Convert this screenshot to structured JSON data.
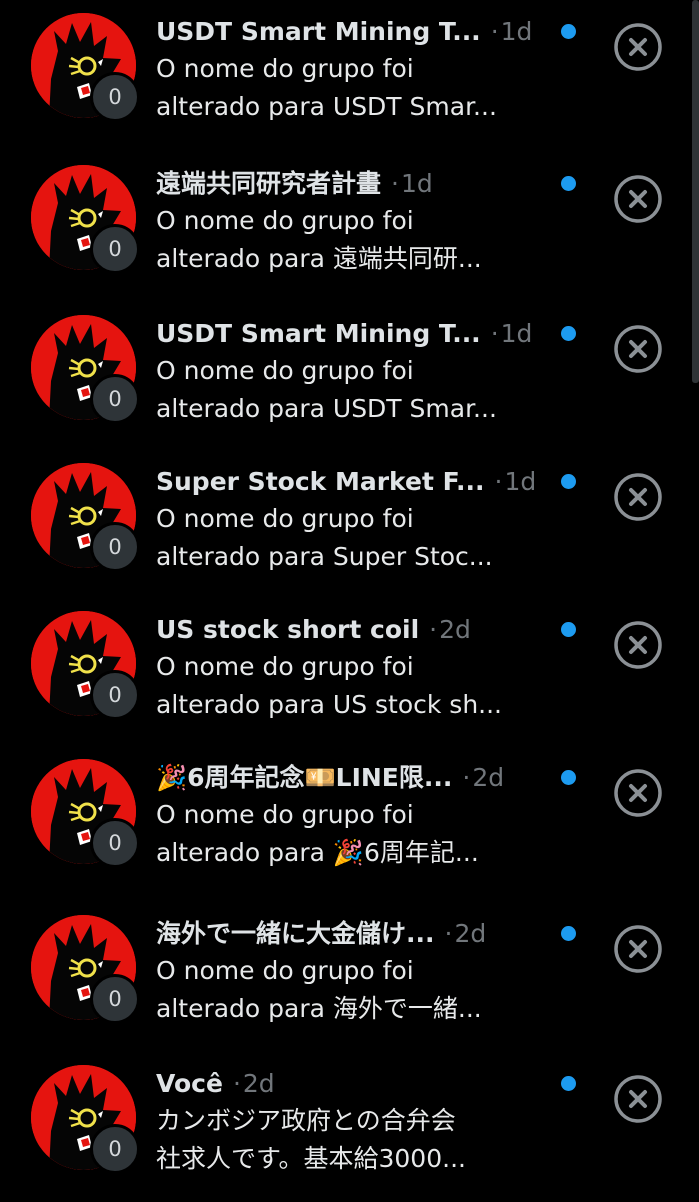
{
  "conversations": [
    {
      "title": "USDT Smart Mining T...",
      "separator": "·",
      "time": "1d",
      "preview_line1": "O nome do grupo foi",
      "preview_line2": "alterado para USDT Smar...",
      "badge": "0",
      "unread": true
    },
    {
      "title": "遠端共同研究者計畫",
      "separator": "·",
      "time": "1d",
      "preview_line1": "O nome do grupo foi",
      "preview_line2": "alterado para 遠端共同研...",
      "badge": "0",
      "unread": true
    },
    {
      "title": "USDT Smart Mining T...",
      "separator": "·",
      "time": "1d",
      "preview_line1": "O nome do grupo foi",
      "preview_line2": "alterado para USDT Smar...",
      "badge": "0",
      "unread": true
    },
    {
      "title": "Super Stock Market F...",
      "separator": "·",
      "time": "1d",
      "preview_line1": "O nome do grupo foi",
      "preview_line2": "alterado para Super Stoc...",
      "badge": "0",
      "unread": true
    },
    {
      "title": "US stock short coil",
      "separator": "·",
      "time": "2d",
      "preview_line1": "O nome do grupo foi",
      "preview_line2": "alterado para US stock sh...",
      "badge": "0",
      "unread": true
    },
    {
      "title": "🎉6周年記念💴LINE限...",
      "separator": "·",
      "time": "2d",
      "preview_line1": "O nome do grupo foi",
      "preview_line2": "alterado para 🎉6周年記...",
      "badge": "0",
      "unread": true
    },
    {
      "title": "海外で一緒に大金儲け...",
      "separator": "·",
      "time": "2d",
      "preview_line1": "O nome do grupo foi",
      "preview_line2": "alterado para 海外で一緒...",
      "badge": "0",
      "unread": true
    },
    {
      "title": "Você",
      "separator": "·",
      "time": "2d",
      "preview_line1": "カンボジア政府との合弁会",
      "preview_line2": "社求人です。基本給3000...",
      "badge": "0",
      "unread": true
    }
  ],
  "icons": {
    "close": "close-circle-icon",
    "avatar": "group-avatar-icon"
  },
  "colors": {
    "background": "#000000",
    "unread_dot": "#1d9bf0",
    "avatar_red": "#e5140f",
    "muted_text": "#71767b",
    "badge_bg": "#2e3438"
  }
}
